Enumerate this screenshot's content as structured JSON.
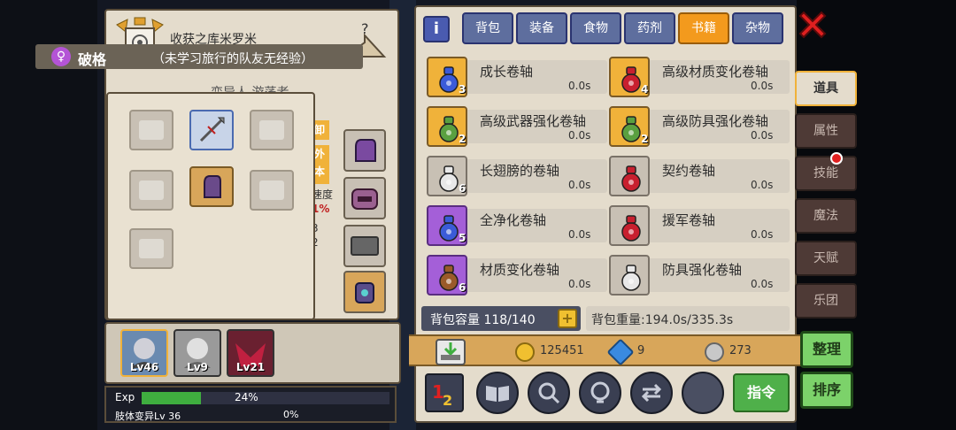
{
  "character": {
    "name": "收获之库米罗米",
    "title_name": "破格",
    "title_note": "（未学习旅行的队友无经验）",
    "subtitle_partial": "变异人 游荡者",
    "side_tags": [
      "卸",
      "外本"
    ],
    "side_stat_label": "速度",
    "side_stat_value": "1%",
    "side_numbers": [
      "3",
      "2"
    ],
    "party": [
      {
        "level": "Lv46"
      },
      {
        "level": "Lv9"
      },
      {
        "level": "Lv21"
      }
    ],
    "exp": {
      "label": "Exp",
      "percent_text": "24%",
      "percent": 0.24,
      "skill_label": "肢体变异Lv 36",
      "skill_percent": "0%"
    }
  },
  "inventory": {
    "tabs": [
      {
        "label": "背包",
        "active": false
      },
      {
        "label": "装备",
        "active": false
      },
      {
        "label": "食物",
        "active": false
      },
      {
        "label": "药剂",
        "active": false
      },
      {
        "label": "书籍",
        "active": true
      },
      {
        "label": "杂物",
        "active": false
      }
    ],
    "items": [
      {
        "name": "成长卷轴",
        "count": "3",
        "weight": "0.0s",
        "color": "#3b5bd8",
        "frame": "gold"
      },
      {
        "name": "高级材质变化卷轴",
        "count": "4",
        "weight": "0.0s",
        "color": "#c8202f",
        "frame": "gold"
      },
      {
        "name": "高级武器强化卷轴",
        "count": "2",
        "weight": "0.0s",
        "color": "#5aa040",
        "frame": "gold"
      },
      {
        "name": "高级防具强化卷轴",
        "count": "2",
        "weight": "0.0s",
        "color": "#5aa040",
        "frame": "gold"
      },
      {
        "name": "长翅膀的卷轴",
        "count": "6",
        "weight": "0.0s",
        "color": "#e8e8e8",
        "frame": "grey"
      },
      {
        "name": "契约卷轴",
        "count": "",
        "weight": "0.0s",
        "color": "#c8202f",
        "frame": "grey"
      },
      {
        "name": "全净化卷轴",
        "count": "5",
        "weight": "0.0s",
        "color": "#3b5bd8",
        "frame": "purple"
      },
      {
        "name": "援军卷轴",
        "count": "",
        "weight": "0.0s",
        "color": "#c8202f",
        "frame": "grey"
      },
      {
        "name": "材质变化卷轴",
        "count": "6",
        "weight": "0.0s",
        "color": "#9a5a2a",
        "frame": "purple"
      },
      {
        "name": "防具强化卷轴",
        "count": "",
        "weight": "0.0s",
        "color": "#e8e8e8",
        "frame": "grey"
      }
    ],
    "capacity": "背包容量 118/140",
    "weight": "背包重量:194.0s/335.3s",
    "currency": {
      "gold": "125451",
      "gems": "9",
      "silver": "273"
    },
    "command_label": "指令"
  },
  "side_tabs": [
    {
      "label": "道具",
      "active": true
    },
    {
      "label": "属性",
      "active": false
    },
    {
      "label": "技能",
      "active": false,
      "alert": true
    },
    {
      "label": "魔法",
      "active": false
    },
    {
      "label": "天赋",
      "active": false
    },
    {
      "label": "乐团",
      "active": false
    }
  ],
  "buttons": {
    "sort": "整理",
    "order": "排序"
  },
  "colors": {
    "accent_tab": "#f39a1d",
    "button_green": "#7cd26a",
    "close_red": "#e02020"
  }
}
